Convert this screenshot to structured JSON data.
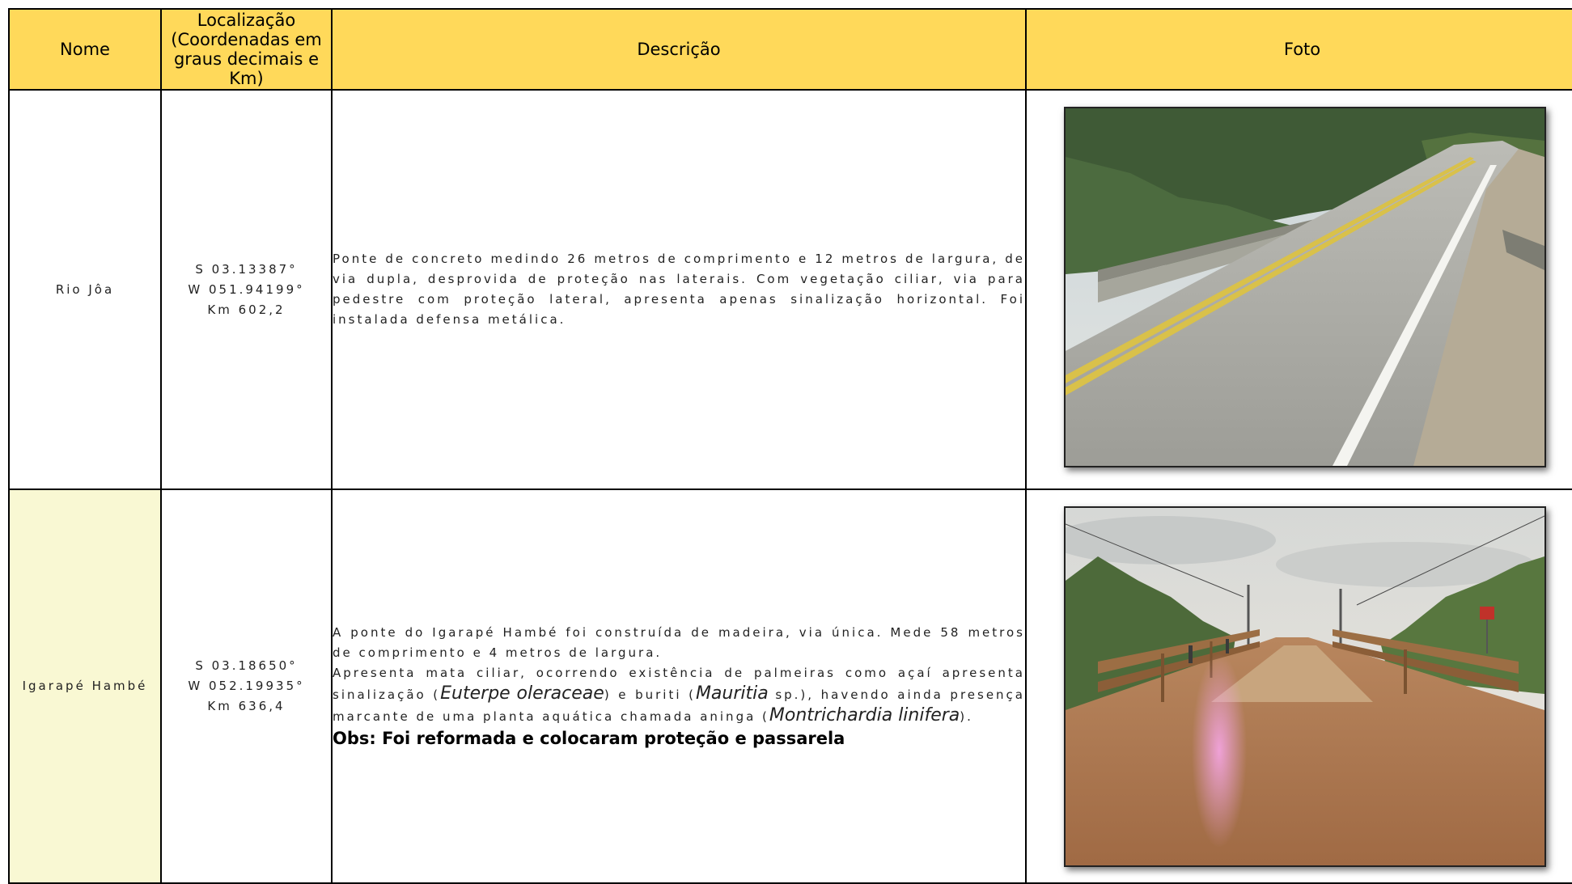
{
  "header": {
    "nome": "Nome",
    "localizacao": "Localização (Coordenadas em graus decimais e Km)",
    "descricao": "Descrição",
    "foto": "Foto"
  },
  "rows": [
    {
      "nome": "Rio Jôa",
      "coord_s": "S 03.13387°",
      "coord_w": "W 051.94199°",
      "km": "Km 602,2",
      "descricao": "Ponte de concreto medindo 26 metros de comprimento e 12 metros de largura, de via dupla, desprovida de proteção nas laterais. Com vegetação ciliar, via para pedestre com proteção lateral, apresenta apenas sinalização horizontal. Foi instalada defensa metálica.",
      "foto_icon": "photo-concrete-bridge"
    },
    {
      "nome": "Igarapé Hambé",
      "coord_s": "S 03.18650°",
      "coord_w": "W 052.19935°",
      "km": "Km 636,4",
      "desc_p1": "A ponte do Igarapé Hambé foi construída de madeira, via única. Mede 58 metros de comprimento e 4 metros de largura.",
      "desc_p2a": "Apresenta mata ciliar, ocorrendo existência de palmeiras como açaí apresenta sinalização (",
      "desc_sp1": "Euterpe oleraceae",
      "desc_p2b": ") e buriti (",
      "desc_sp2": "Mauritia",
      "desc_p2c": " sp.), havendo ainda presença marcante de uma planta aquática chamada aninga (",
      "desc_sp3": "Montrichardia linifera",
      "desc_p2d": ").",
      "obs": "Obs: Foi reformada e colocaram proteção e passarela",
      "foto_icon": "photo-wooden-bridge"
    }
  ],
  "colors": {
    "header_bg": "#ffd95a",
    "tinted_cell": "#f9f8d3",
    "border": "#000000"
  }
}
